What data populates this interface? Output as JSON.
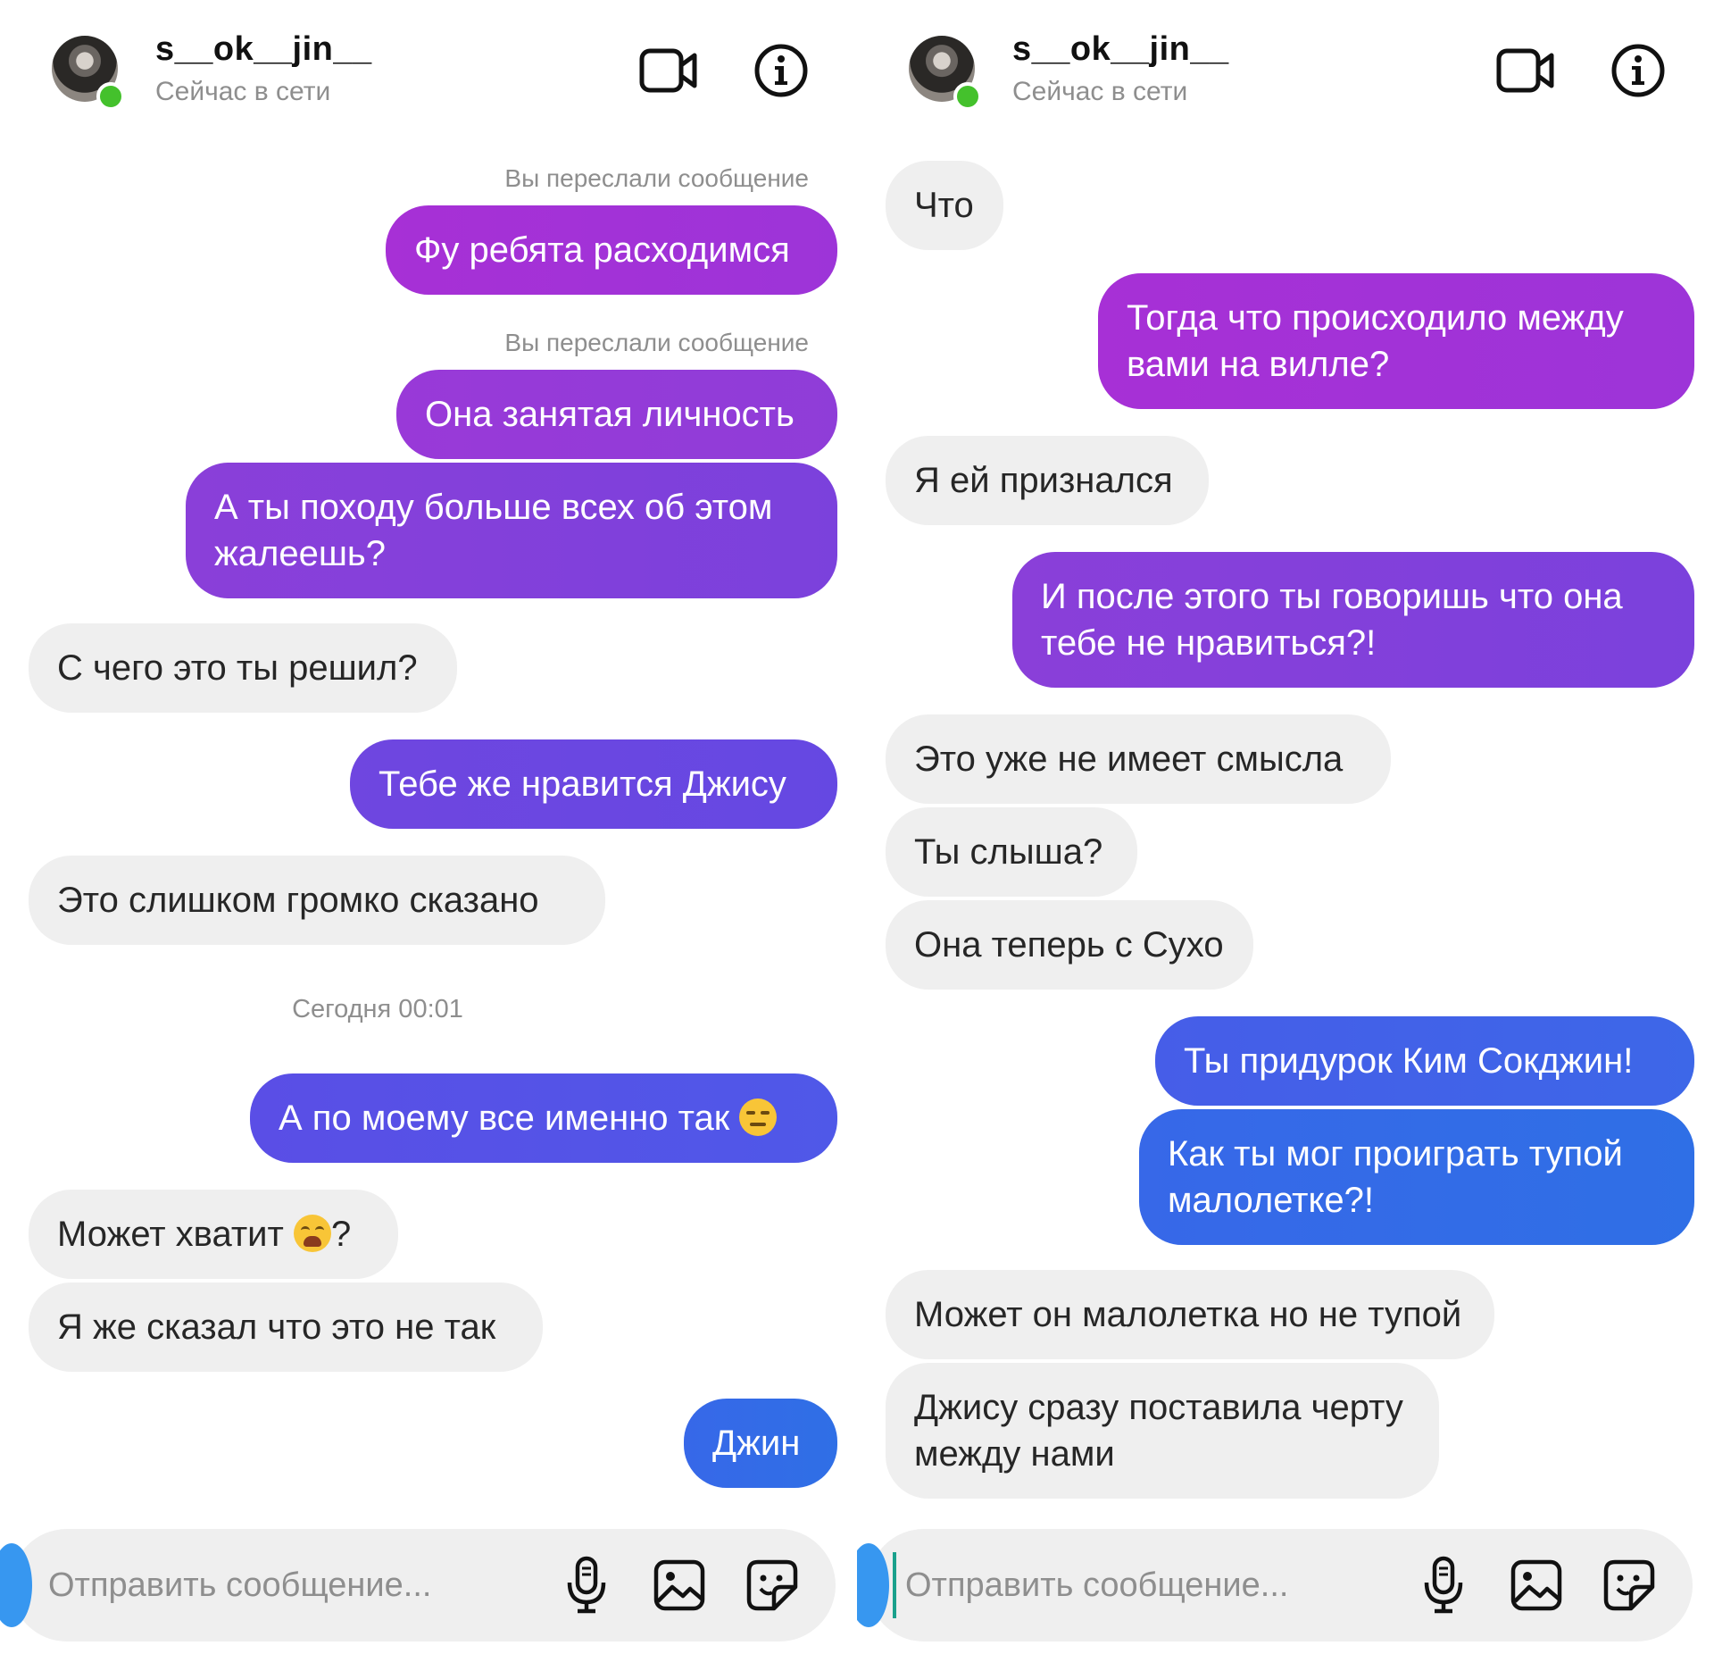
{
  "colors": {
    "online": "#44c12c",
    "incoming_bubble": "#efefef",
    "muted_text": "#8e8e8e",
    "bubble_gradient_top": "#a730d6",
    "bubble_gradient_bottom": "#2f6fe6"
  },
  "icons": {
    "video": "video-camera-icon",
    "info": "info-circle-icon",
    "mic": "microphone-icon",
    "gallery": "image-gallery-icon",
    "sticker": "sticker-icon"
  },
  "panels": [
    {
      "header": {
        "username": "s__ok__jin__",
        "status": "Сейчас в сети"
      },
      "messages": [
        {
          "forward_note": "Вы переслали сообщение"
        },
        {
          "text": "Фу ребята расходимся"
        },
        {
          "forward_note": "Вы переслали сообщение"
        },
        {
          "text": "Она занятая личность"
        },
        {
          "text": "А ты походу больше всех об этом жалеешь?"
        },
        {
          "text": "С чего это ты решил?"
        },
        {
          "text": "Тебе же нравится Джису"
        },
        {
          "text": "Это слишком громко сказано"
        },
        {
          "time": "Сегодня 00:01"
        },
        {
          "text": "А по моему все именно так",
          "emoji": "expressionless-face"
        },
        {
          "text": "Может хватит",
          "emoji": "weary-face",
          "suffix": "?"
        },
        {
          "text": "Я же сказал что это не так"
        },
        {
          "text": "Джин"
        }
      ],
      "composer": {
        "placeholder": "Отправить сообщение..."
      }
    },
    {
      "header": {
        "username": "s__ok__jin__",
        "status": "Сейчас в сети"
      },
      "messages": [
        {
          "text": "Что"
        },
        {
          "text": "Тогда что происходило между вами на вилле?"
        },
        {
          "text": "Я ей признался"
        },
        {
          "text": "И после этого ты говоришь что она тебе не нравиться?!"
        },
        {
          "text": "Это уже не имеет смысла"
        },
        {
          "text": "Ты слыша?"
        },
        {
          "text": "Она теперь с Сухо"
        },
        {
          "text": "Ты придурок Ким Сокджин!"
        },
        {
          "text": "Как ты мог проиграть тупой малолетке?!"
        },
        {
          "text": "Может он малолетка но не тупой"
        },
        {
          "text": "Джису сразу поставила черту между нами"
        }
      ],
      "composer": {
        "placeholder": "Отправить сообщение..."
      }
    }
  ]
}
